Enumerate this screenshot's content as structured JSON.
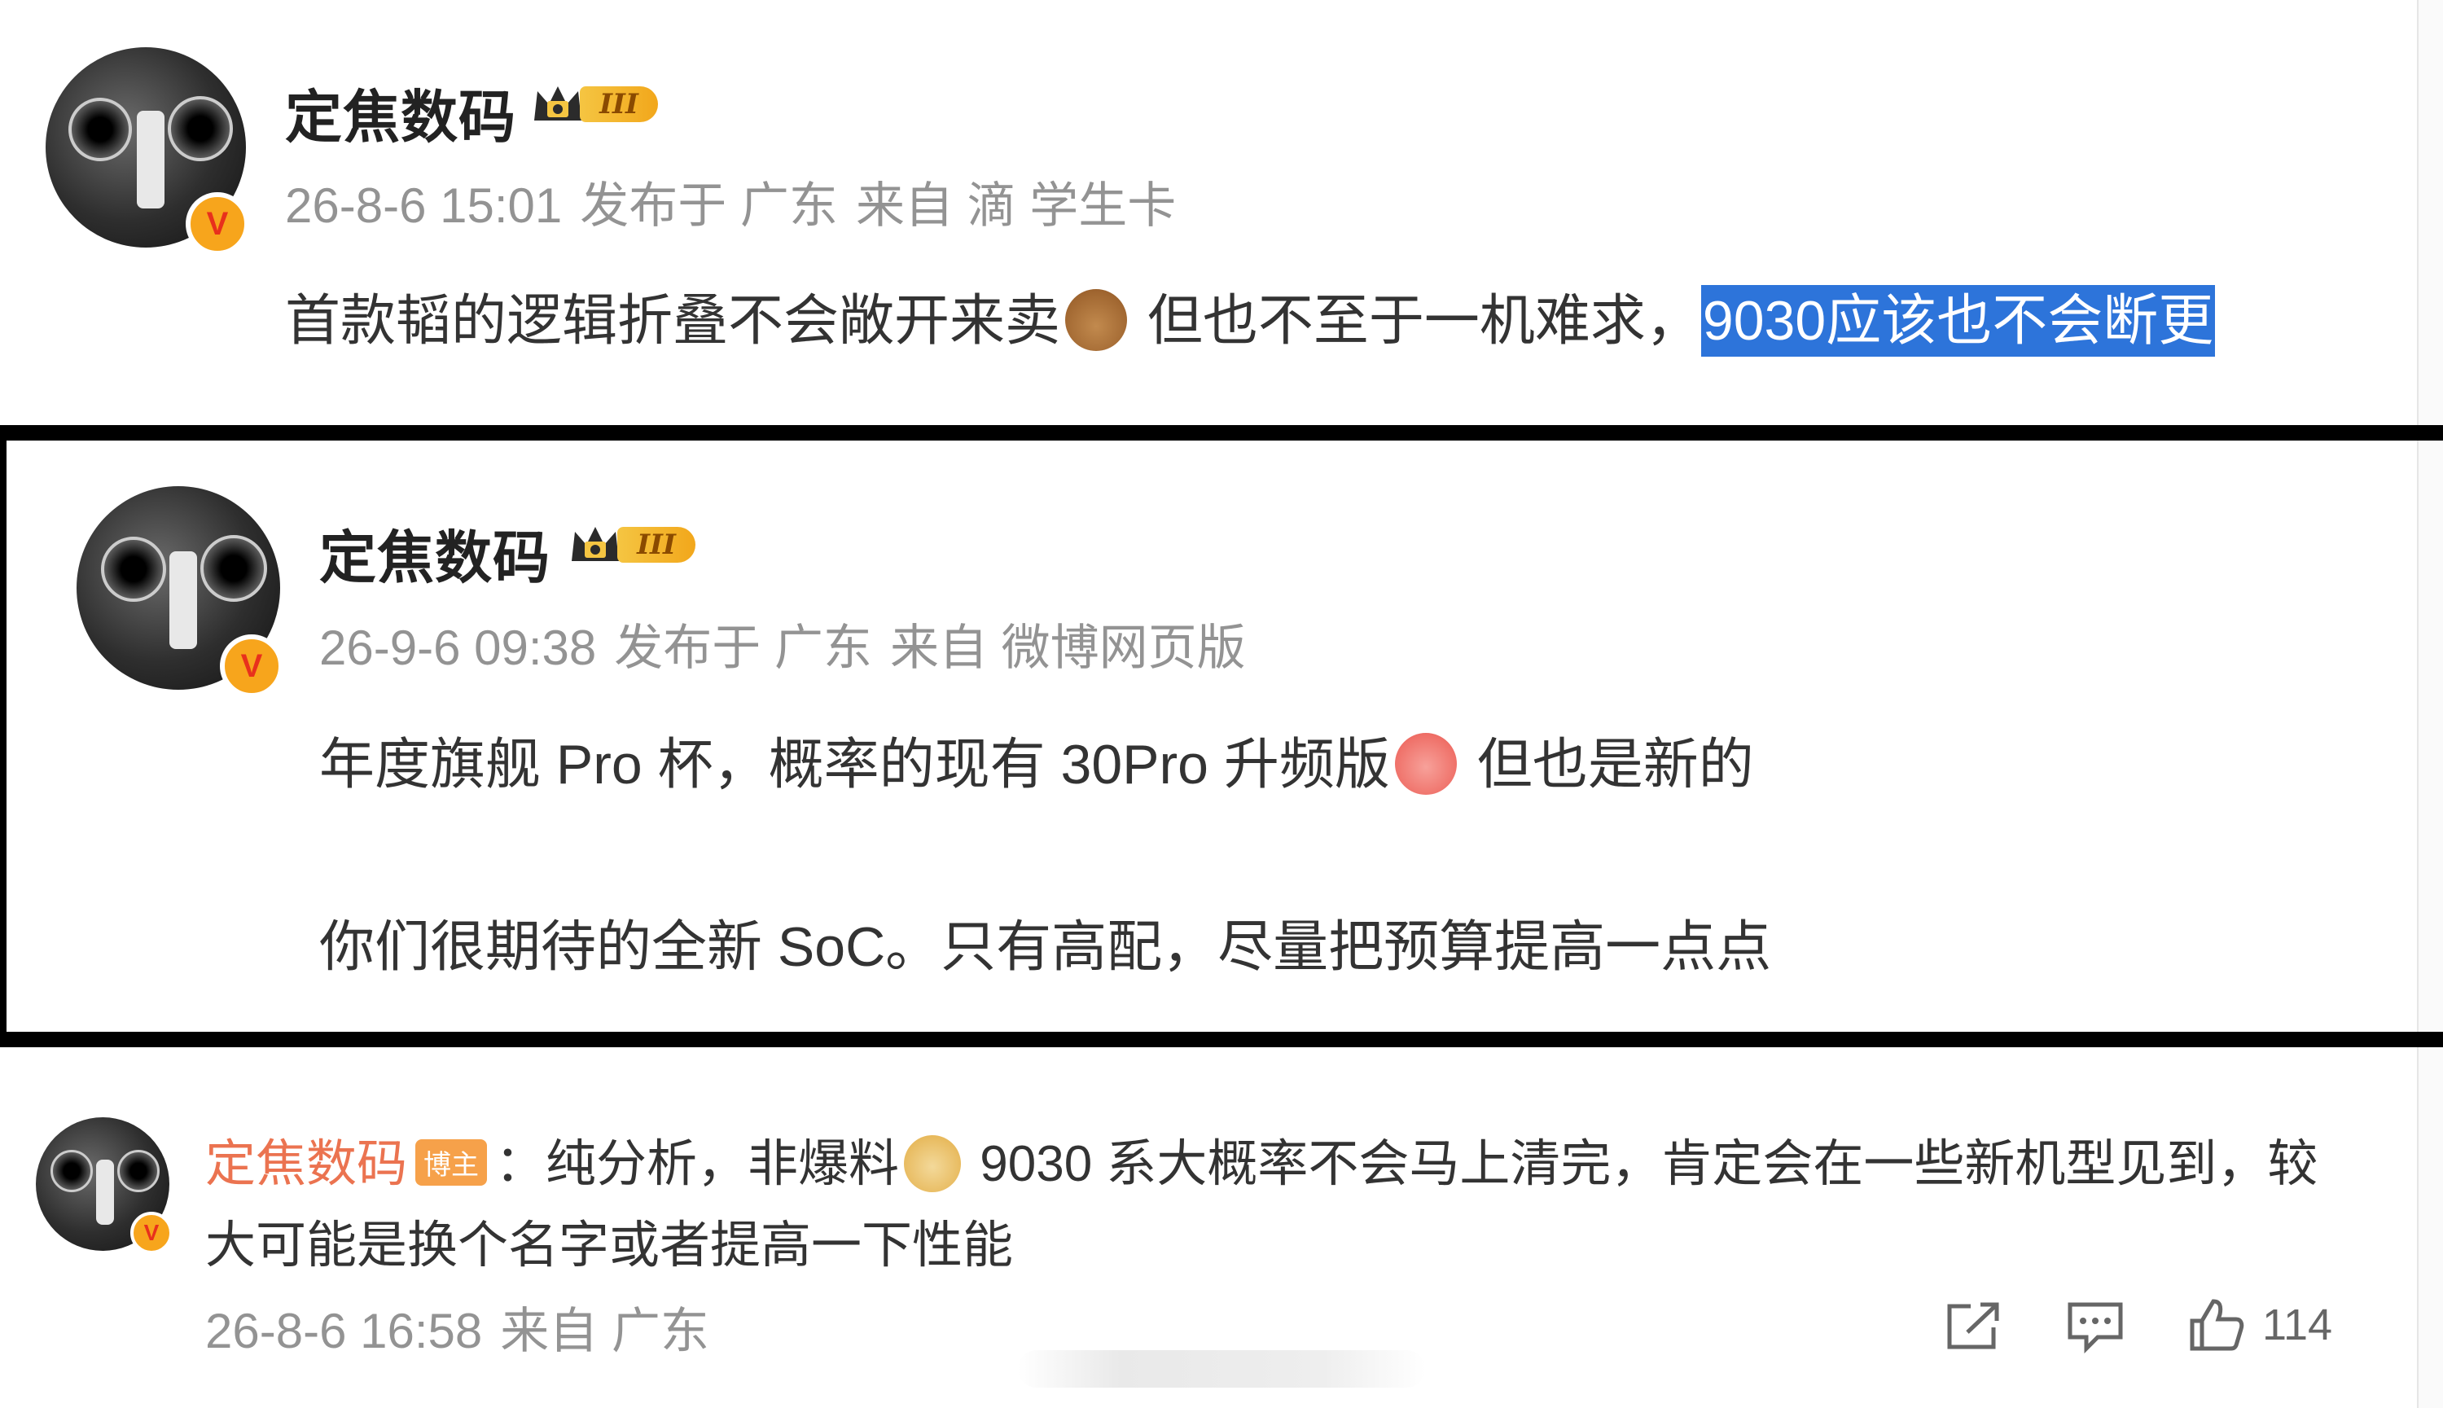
{
  "posts": [
    {
      "username": "定焦数码",
      "level_badge": "III",
      "meta": {
        "time": "26-8-6 15:01",
        "location": "发布于 广东",
        "source": "来自 滴 学生卡"
      },
      "text_before": "首款韬的逻辑折叠不会敞开来卖",
      "text_after_emoji": " 但也不至于一机难求，",
      "text_highlight": "9030应该也不会断更"
    },
    {
      "username": "定焦数码",
      "level_badge": "III",
      "meta": {
        "time": "26-9-6 09:38",
        "location": "发布于 广东",
        "source": "来自 微博网页版"
      },
      "line1_before": "年度旗舰 Pro 杯，概率的现有 30Pro 升频版",
      "line1_after": " 但也是新的",
      "line2": "你们很期待的全新 SoC。只有高配，尽量把预算提高一点点"
    }
  ],
  "comment": {
    "username": "定焦数码",
    "host_badge": "博主",
    "line1_before": "：纯分析，非爆料",
    "line1_after": " 9030 系大概率不会马上清完，肯定会在一些新机型见到，较",
    "line2": "大可能是换个名字或者提高一下性能",
    "time": "26-8-6 16:58",
    "location": "来自 广东",
    "like_count": "114",
    "icons": [
      "share-icon",
      "comment-icon",
      "like-icon"
    ]
  },
  "colors": {
    "highlight": "#2d74da",
    "name_orange": "#eb7350",
    "meta_gray": "#939393"
  }
}
